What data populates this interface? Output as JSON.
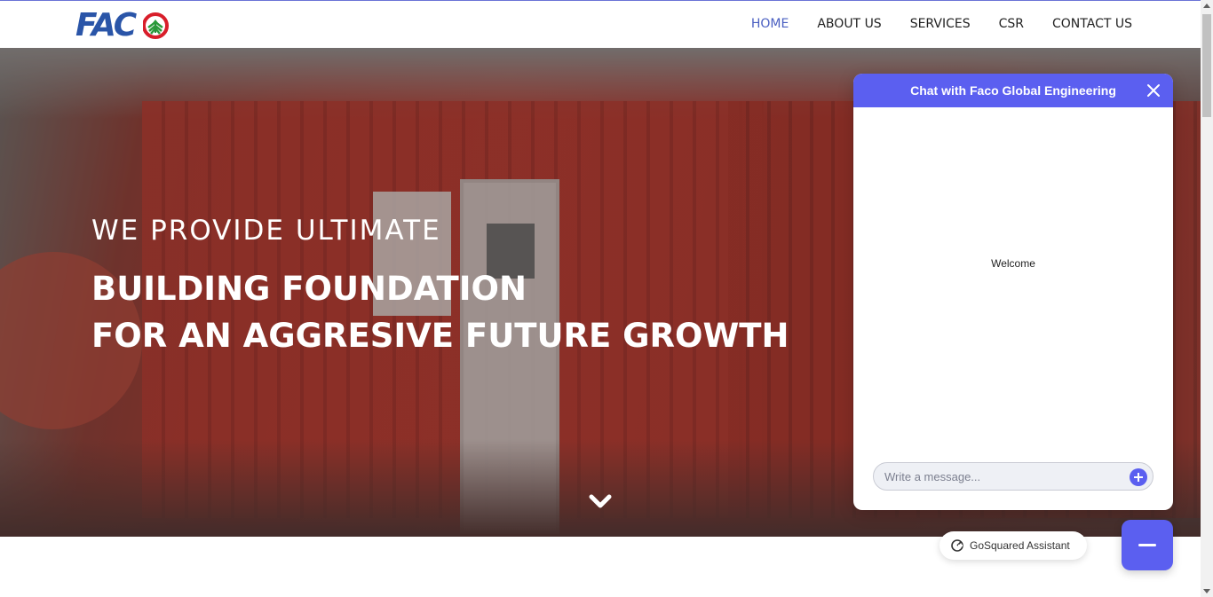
{
  "brand": {
    "logo_text": "FACO",
    "logo_icon": "faco-leaf-icon"
  },
  "nav": {
    "items": [
      {
        "label": "HOME",
        "active": true
      },
      {
        "label": "ABOUT US",
        "active": false
      },
      {
        "label": "SERVICES",
        "active": false
      },
      {
        "label": "CSR",
        "active": false
      },
      {
        "label": "CONTACT US",
        "active": false
      }
    ],
    "active_color": "#4a5fc1"
  },
  "hero": {
    "subtitle": "WE PROVIDE ULTIMATE",
    "line1": "BUILDING FOUNDATION",
    "line2": "FOR AN AGGRESIVE FUTURE GROWTH",
    "scroll_icon": "chevron-down-icon"
  },
  "chat": {
    "title": "Chat with Faco Global Engineering",
    "welcome": "Welcome",
    "input_placeholder": "Write a message...",
    "close_icon": "close-icon",
    "add_icon": "plus-circle-icon",
    "accent_color": "#5b5ff0"
  },
  "assistant_badge": {
    "label": "GoSquared Assistant",
    "icon": "gosquared-icon"
  },
  "chat_toggle": {
    "icon": "minimize-icon"
  }
}
